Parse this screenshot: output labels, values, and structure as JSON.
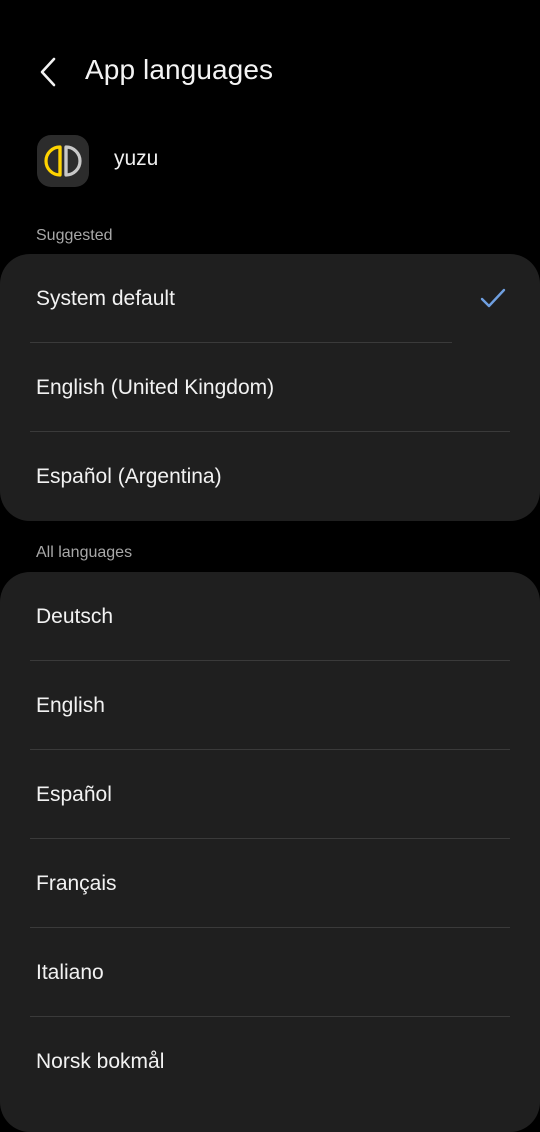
{
  "header": {
    "title": "App languages",
    "back_icon": "chevron-left-icon"
  },
  "app": {
    "name": "yuzu",
    "icon": "yuzu-app-icon",
    "icon_colors": {
      "left": "#ffd400",
      "right": "#c8c8c8"
    }
  },
  "suggested": {
    "label": "Suggested",
    "items": [
      {
        "label": "System default",
        "selected": true
      },
      {
        "label": "English (United Kingdom)",
        "selected": false
      },
      {
        "label": "Español (Argentina)",
        "selected": false
      }
    ]
  },
  "all_languages": {
    "label": "All languages",
    "items": [
      {
        "label": "Deutsch"
      },
      {
        "label": "English"
      },
      {
        "label": "Español"
      },
      {
        "label": "Français"
      },
      {
        "label": "Italiano"
      },
      {
        "label": "Norsk bokmål"
      }
    ]
  },
  "colors": {
    "background": "#000000",
    "card": "#1f1f1f",
    "accent_check": "#6f9fe0",
    "section_label": "#a8a8a8"
  }
}
